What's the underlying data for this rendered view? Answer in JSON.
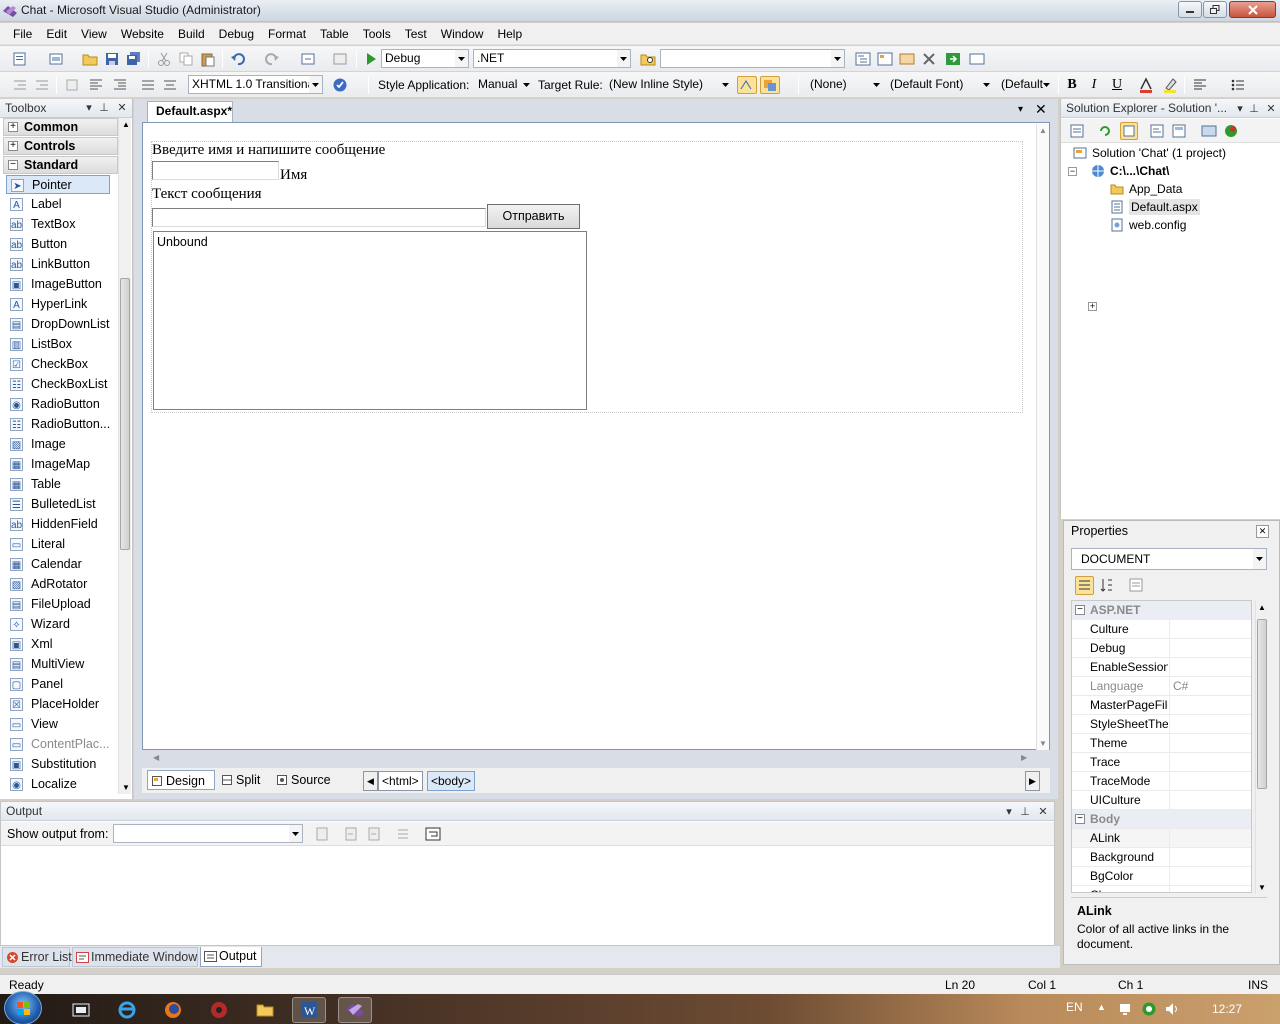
{
  "window": {
    "title": "Chat - Microsoft Visual Studio (Administrator)"
  },
  "menu": [
    "File",
    "Edit",
    "View",
    "Website",
    "Build",
    "Debug",
    "Format",
    "Table",
    "Tools",
    "Test",
    "Window",
    "Help"
  ],
  "toolbar1": {
    "config": "Debug",
    "platform": ".NET",
    "search": ""
  },
  "toolbar2": {
    "doctype": "XHTML 1.0 Transitiona",
    "style_app_label": "Style Application:",
    "style_app_value": "Manual",
    "target_rule_label": "Target Rule:",
    "target_rule_value": "(New Inline Style)",
    "style_value": "(None)",
    "font_value": "(Default Font)",
    "size_value": "(Default",
    "bold": "B",
    "italic": "I",
    "underline": "U"
  },
  "toolbox": {
    "title": "Toolbox",
    "groups": [
      "Common",
      "Controls",
      "Standard"
    ],
    "items": [
      "Pointer",
      "Label",
      "TextBox",
      "Button",
      "LinkButton",
      "ImageButton",
      "HyperLink",
      "DropDownList",
      "ListBox",
      "CheckBox",
      "CheckBoxList",
      "RadioButton",
      "RadioButton...",
      "Image",
      "ImageMap",
      "Table",
      "BulletedList",
      "HiddenField",
      "Literal",
      "Calendar",
      "AdRotator",
      "FileUpload",
      "Wizard",
      "Xml",
      "MultiView",
      "Panel",
      "PlaceHolder",
      "View",
      "ContentPlac...",
      "Substitution",
      "Localize"
    ]
  },
  "editor": {
    "tab": "Default.aspx*",
    "heading": "Введите имя и напишите сообщение",
    "name_label": "Имя",
    "message_label": "Текст сообщения",
    "send_button": "Отправить",
    "listbox_text": "Unbound",
    "views": [
      "Design",
      "Split",
      "Source"
    ],
    "tags": [
      "<html>",
      "<body>"
    ]
  },
  "solution": {
    "title": "Solution Explorer - Solution '...",
    "root": "Solution 'Chat' (1 project)",
    "project": "C:\\...\\Chat\\",
    "items": [
      "App_Data",
      "Default.aspx",
      "web.config"
    ]
  },
  "properties": {
    "title": "Properties",
    "object": "DOCUMENT",
    "categories": {
      "asp": "ASP.NET",
      "body": "Body"
    },
    "asp_rows": [
      {
        "name": "Culture",
        "value": ""
      },
      {
        "name": "Debug",
        "value": ""
      },
      {
        "name": "EnableSession",
        "value": ""
      },
      {
        "name": "Language",
        "value": "C#"
      },
      {
        "name": "MasterPageFile",
        "value": ""
      },
      {
        "name": "StyleSheetTheme",
        "value": ""
      },
      {
        "name": "Theme",
        "value": ""
      },
      {
        "name": "Trace",
        "value": ""
      },
      {
        "name": "TraceMode",
        "value": ""
      },
      {
        "name": "UICulture",
        "value": ""
      }
    ],
    "body_rows": [
      {
        "name": "ALink",
        "value": ""
      },
      {
        "name": "Background",
        "value": ""
      },
      {
        "name": "BgColor",
        "value": ""
      },
      {
        "name": "Class",
        "value": ""
      }
    ],
    "desc_title": "ALink",
    "desc_text": "Color of all active links in the document."
  },
  "output": {
    "title": "Output",
    "show_from_label": "Show output from:",
    "show_from_value": ""
  },
  "bottom_tabs": [
    "Error List",
    "Immediate Window",
    "Output"
  ],
  "status": {
    "ready": "Ready",
    "ln": "Ln 20",
    "col": "Col 1",
    "ch": "Ch 1",
    "mode": "INS"
  },
  "taskbar": {
    "lang": "EN",
    "time": "12:27"
  }
}
